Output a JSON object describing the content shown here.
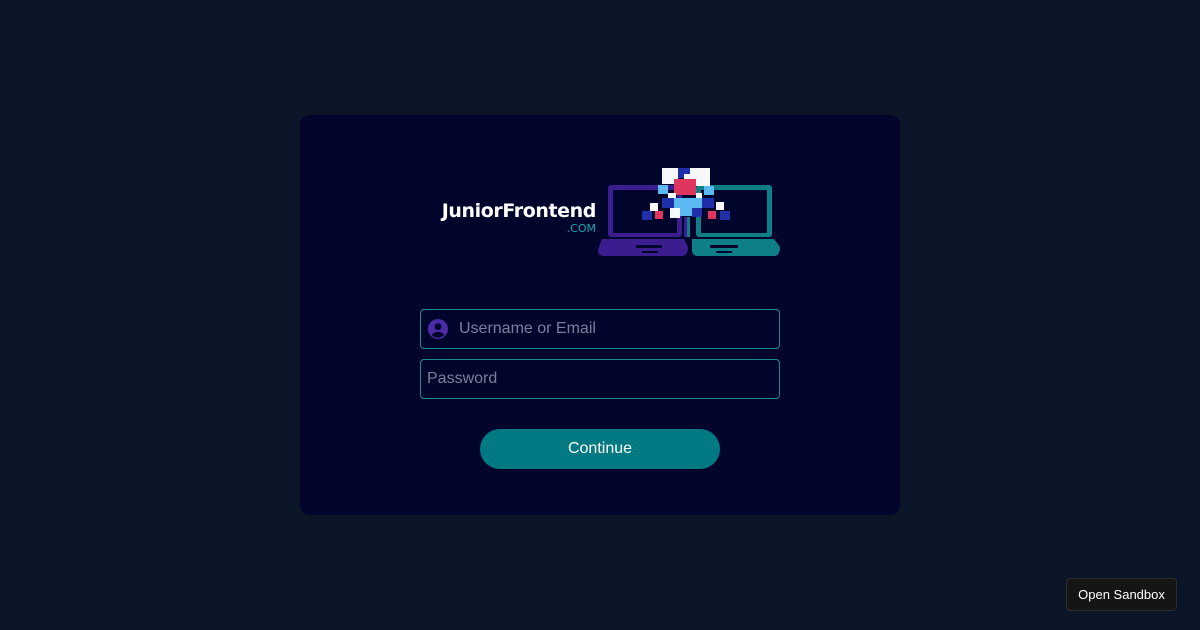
{
  "logo": {
    "name": "JuniorFrontend",
    "tld": ".COM",
    "graphic": "two-laptops-pixel-art-logo"
  },
  "form": {
    "username": {
      "placeholder": "Username or Email",
      "value": "",
      "icon": "user-circle-icon"
    },
    "password": {
      "placeholder": "Password",
      "value": ""
    },
    "continue_label": "Continue"
  },
  "sandbox": {
    "label": "Open Sandbox"
  },
  "colors": {
    "page_background": "#0a1628",
    "card_background": "#02052b",
    "accent_teal": "#007a82",
    "field_border": "#1b8a95",
    "laptop_purple": "#3b1d8f",
    "laptop_teal": "#0e7f86",
    "pixel_red": "#e0355c",
    "pixel_lightblue": "#5cb8f0",
    "pixel_navy": "#1e2fa8"
  }
}
